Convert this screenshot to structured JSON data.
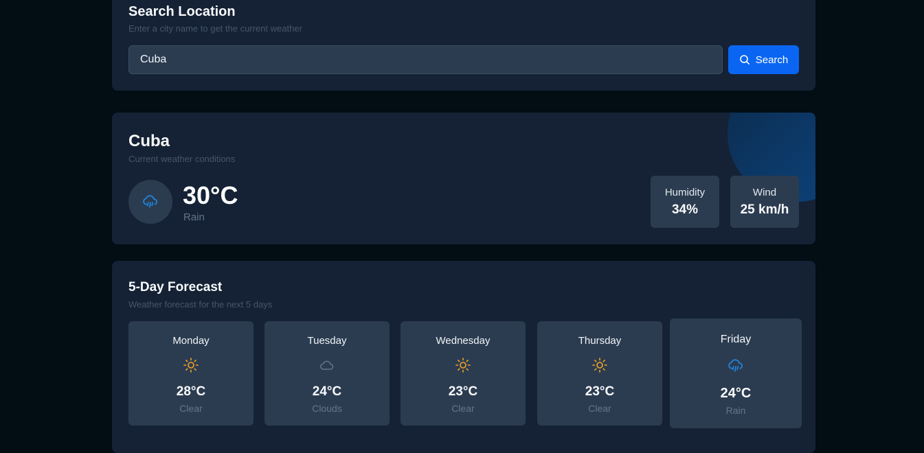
{
  "search": {
    "title": "Search Location",
    "subtitle": "Enter a city name to get the current weather",
    "value": "Cuba",
    "button_label": "Search",
    "button_icon": "search-icon",
    "accent_color": "#0a66f2"
  },
  "current": {
    "location": "Cuba",
    "subtitle": "Current weather conditions",
    "temperature": "30°C",
    "condition": "Rain",
    "condition_icon": "rain-cloud-icon",
    "humidity_label": "Humidity",
    "humidity_value": "34%",
    "wind_label": "Wind",
    "wind_value": "25 km/h"
  },
  "forecast": {
    "title": "5-Day Forecast",
    "subtitle": "Weather forecast for the next 5 days",
    "days": [
      {
        "day": "Monday",
        "temp": "28°C",
        "condition": "Clear",
        "icon": "sun-icon"
      },
      {
        "day": "Tuesday",
        "temp": "24°C",
        "condition": "Clouds",
        "icon": "cloud-icon"
      },
      {
        "day": "Wednesday",
        "temp": "23°C",
        "condition": "Clear",
        "icon": "sun-icon"
      },
      {
        "day": "Thursday",
        "temp": "23°C",
        "condition": "Clear",
        "icon": "sun-icon"
      },
      {
        "day": "Friday",
        "temp": "24°C",
        "condition": "Rain",
        "icon": "rain-cloud-icon"
      }
    ]
  },
  "colors": {
    "background": "#020d14",
    "card": "#152235",
    "inner": "#2c3c50",
    "sun": "#f5a524",
    "rain": "#1e88e5",
    "cloud": "#64748b"
  }
}
